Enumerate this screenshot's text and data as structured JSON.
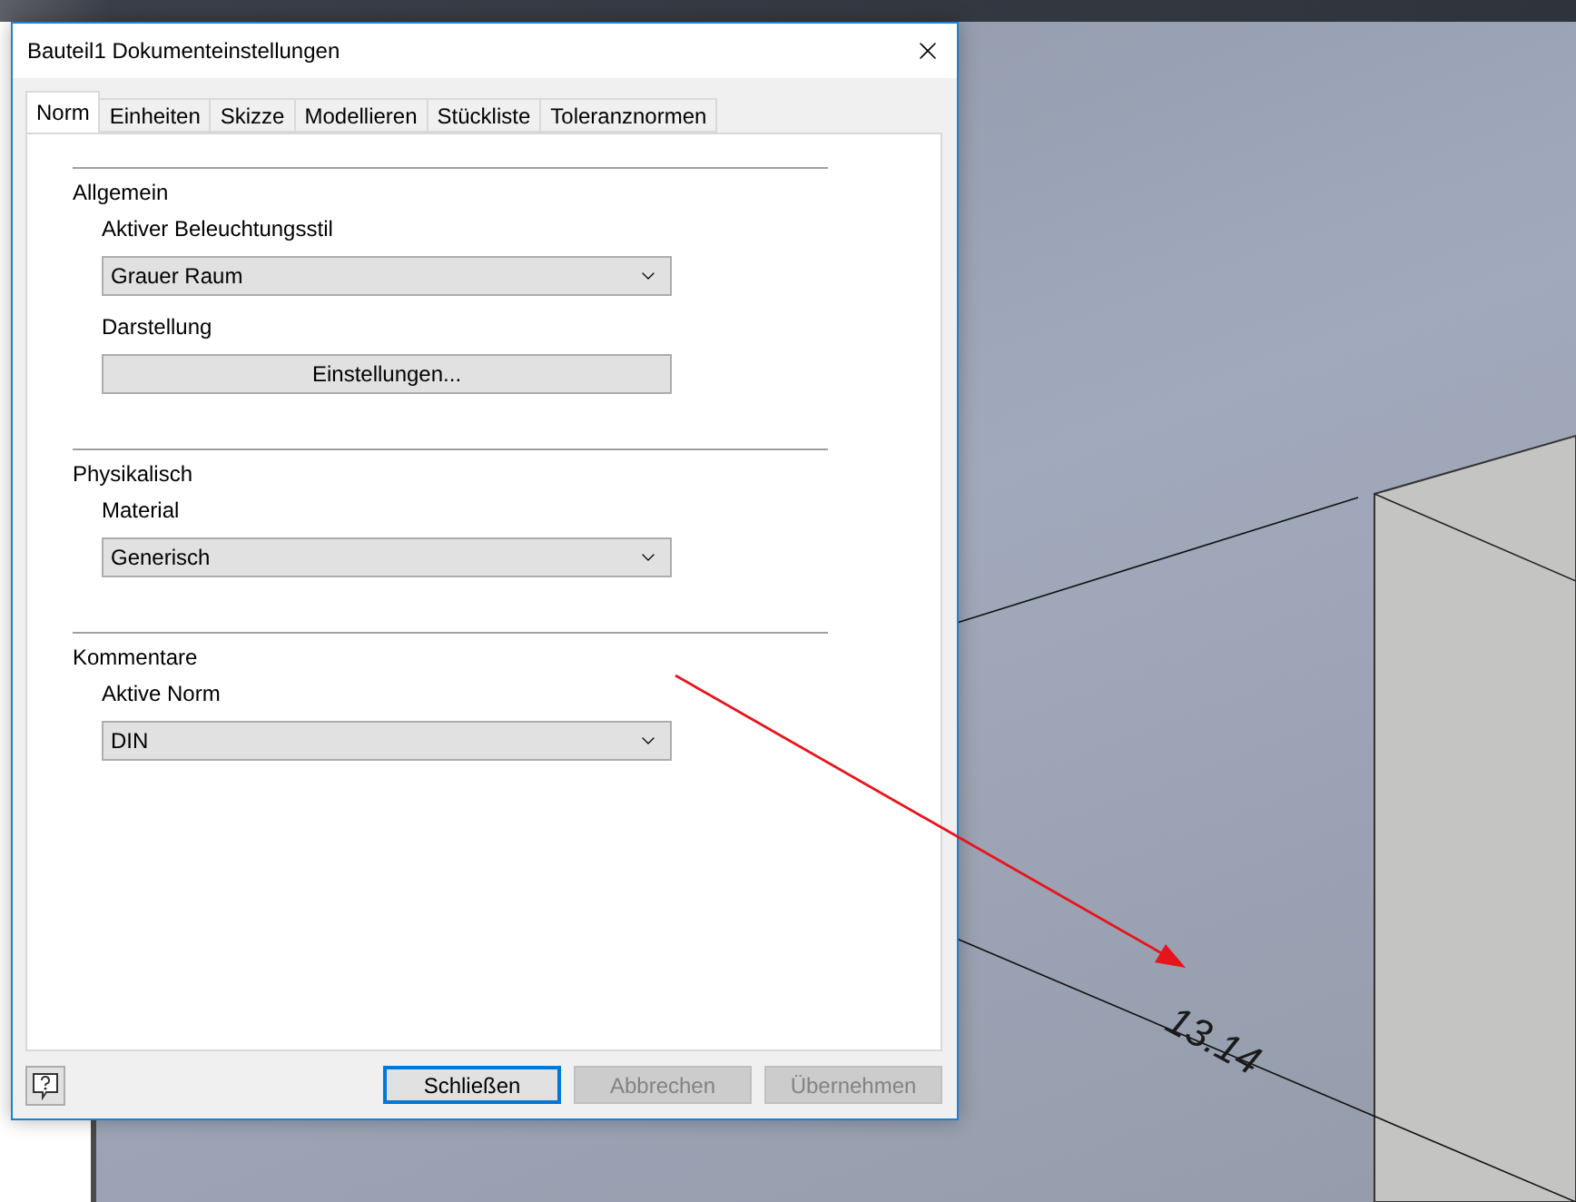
{
  "window": {
    "title": "Bauteil1 Dokumenteinstellungen"
  },
  "tabs": [
    {
      "label": "Norm",
      "selected": true
    },
    {
      "label": "Einheiten",
      "selected": false
    },
    {
      "label": "Skizze",
      "selected": false
    },
    {
      "label": "Modellieren",
      "selected": false
    },
    {
      "label": "Stückliste",
      "selected": false
    },
    {
      "label": "Toleranznormen",
      "selected": false
    }
  ],
  "sections": [
    {
      "heading": "Allgemein",
      "fields": [
        {
          "kind": "dropdown",
          "label": "Aktiver Beleuchtungsstil",
          "value": "Grauer Raum"
        },
        {
          "kind": "button",
          "label": "Darstellung",
          "value": "Einstellungen..."
        }
      ]
    },
    {
      "heading": "Physikalisch",
      "fields": [
        {
          "kind": "dropdown",
          "label": "Material",
          "value": "Generisch"
        }
      ]
    },
    {
      "heading": "Kommentare",
      "fields": [
        {
          "kind": "dropdown",
          "label": "Aktive Norm",
          "value": "DIN"
        }
      ]
    }
  ],
  "footer_buttons": [
    {
      "label": "Schließen",
      "disabled": false,
      "default": true
    },
    {
      "label": "Abbrechen",
      "disabled": true,
      "default": false
    },
    {
      "label": "Übernehmen",
      "disabled": true,
      "default": false
    }
  ],
  "viewport": {
    "dimension": "13.14"
  }
}
